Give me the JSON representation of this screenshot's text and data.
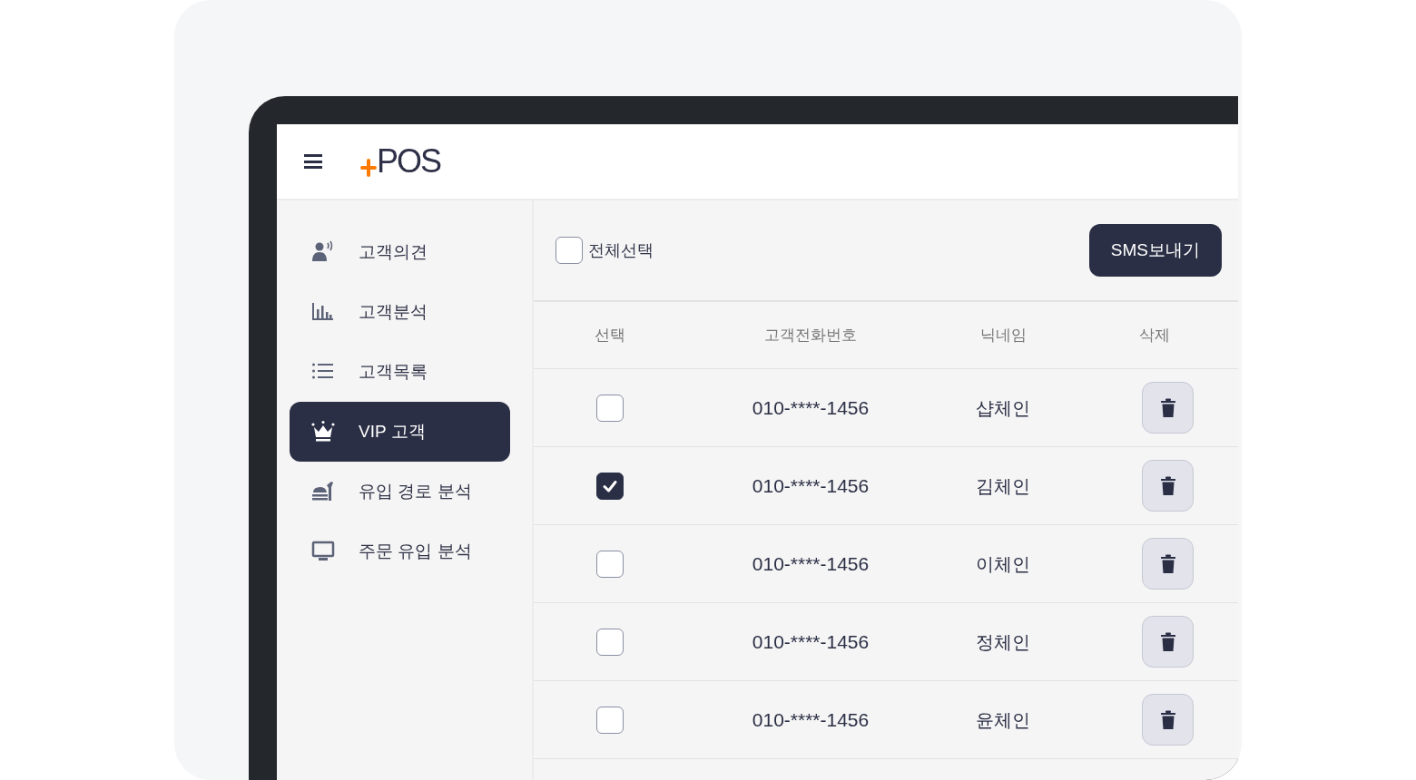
{
  "header": {
    "logo": "POS"
  },
  "sidebar": {
    "items": [
      {
        "kind": "person",
        "label": "고객의견",
        "selected": false
      },
      {
        "kind": "chart",
        "label": "고객분석",
        "selected": false
      },
      {
        "kind": "list",
        "label": "고객목록",
        "selected": false
      },
      {
        "kind": "crown",
        "label": "VIP 고객",
        "selected": true
      },
      {
        "kind": "food",
        "label": "유입 경로 분석",
        "selected": false
      },
      {
        "kind": "monitor",
        "label": "주문 유입 분석",
        "selected": false
      }
    ]
  },
  "toolbar": {
    "select_all": {
      "label": "전체선택",
      "checked": false
    },
    "send_button": "SMS보내기"
  },
  "table": {
    "columns": [
      "선택",
      "고객전화번호",
      "닉네임",
      "삭제"
    ],
    "rows": [
      {
        "checked": false,
        "phone": "010-****-1456",
        "nickname": "샵체인"
      },
      {
        "checked": true,
        "phone": "010-****-1456",
        "nickname": "김체인"
      },
      {
        "checked": false,
        "phone": "010-****-1456",
        "nickname": "이체인"
      },
      {
        "checked": false,
        "phone": "010-****-1456",
        "nickname": "정체인"
      },
      {
        "checked": false,
        "phone": "010-****-1456",
        "nickname": "윤체인"
      }
    ]
  }
}
